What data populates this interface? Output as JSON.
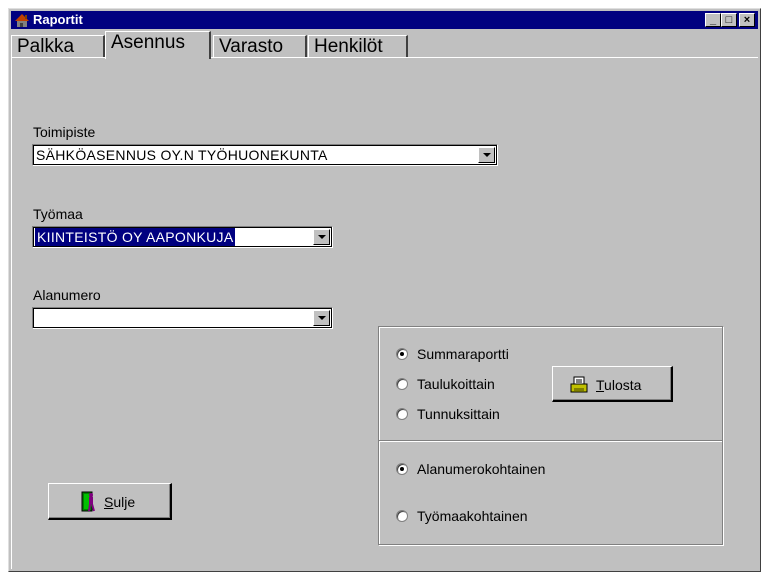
{
  "window": {
    "title": "Raportit",
    "minimize": "_",
    "maximize": "□",
    "close": "×"
  },
  "tabs": [
    {
      "label": "Palkka"
    },
    {
      "label": "Asennus"
    },
    {
      "label": "Varasto"
    },
    {
      "label": "Henkilöt"
    }
  ],
  "form": {
    "toimipiste": {
      "label": "Toimipiste",
      "value": "SÄHKÖASENNUS OY.N TYÖHUONEKUNTA"
    },
    "tyomaa": {
      "label": "Työmaa",
      "value": "KIINTEISTÖ OY AAPONKUJA"
    },
    "alanumero": {
      "label": "Alanumero",
      "value": ""
    }
  },
  "report_type": {
    "options": [
      "Summaraportti",
      "Taulukoittain",
      "Tunnuksittain"
    ],
    "selected": "Summaraportti"
  },
  "scope": {
    "options": [
      "Alanumerokohtainen",
      "Työmaakohtainen"
    ],
    "selected": "Alanumerokohtainen"
  },
  "buttons": {
    "print": {
      "mnemonic": "T",
      "rest": "ulosta"
    },
    "close": {
      "mnemonic": "S",
      "rest": "ulje"
    }
  }
}
